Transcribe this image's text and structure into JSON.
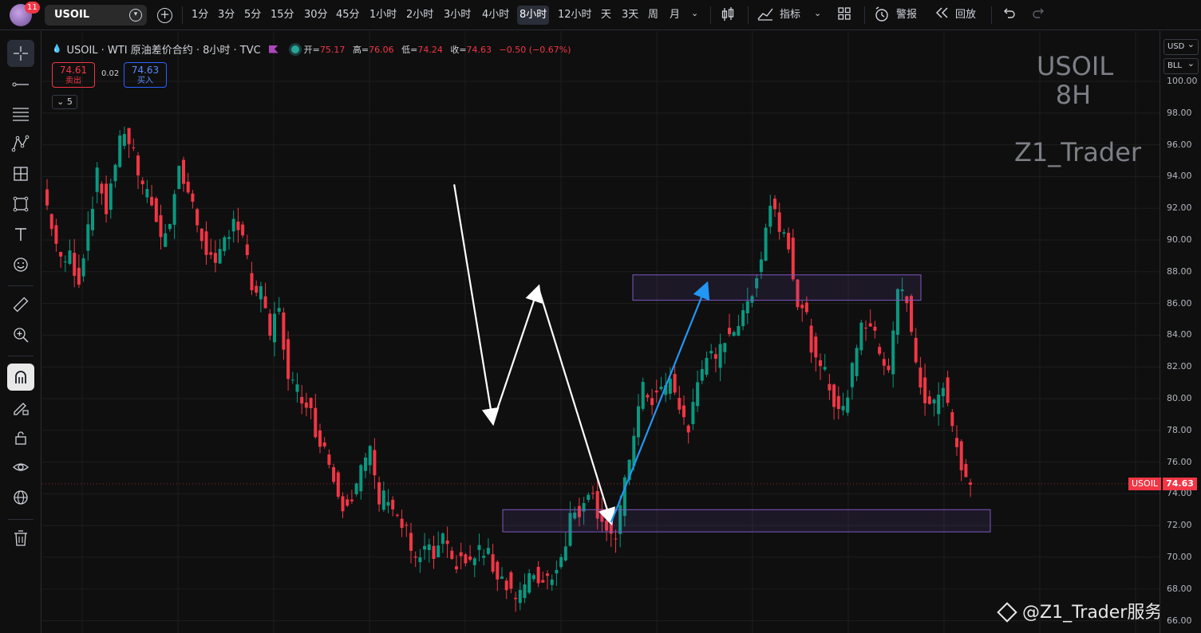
{
  "topbar": {
    "notifications": "11",
    "symbol": "USOIL",
    "intervals": [
      "1分",
      "3分",
      "5分",
      "15分",
      "30分",
      "45分",
      "1小时",
      "2小时",
      "3小时",
      "4小时",
      "8小时",
      "12小时",
      "天",
      "3天",
      "周",
      "月"
    ],
    "active_interval": "8小时",
    "indicators_label": "指标",
    "alert_label": "警报",
    "replay_label": "回放"
  },
  "legend": {
    "title": "USOIL · WTI 原油差价合约 · 8小时 · TVC",
    "open_key": "开=",
    "open": "75.17",
    "high_key": "高=",
    "high": "76.06",
    "low_key": "低=",
    "low": "74.24",
    "close_key": "收=",
    "close": "74.63",
    "change": "−0.50 (−0.67%)",
    "sell_price": "74.61",
    "sell_label": "卖出",
    "spread": "0.02",
    "buy_price": "74.63",
    "buy_label": "买入",
    "indicator_count": "5"
  },
  "watermark": {
    "symbol": "USOIL",
    "interval": "8H",
    "author": "Z1_Trader",
    "footer": "@Z1_Trader服务号"
  },
  "axis": {
    "currency": "USD",
    "unit": "BLL",
    "labels": [
      "100.00",
      "98.00",
      "96.00",
      "94.00",
      "92.00",
      "90.00",
      "88.00",
      "86.00",
      "84.00",
      "82.00",
      "80.00",
      "78.00",
      "76.00",
      "74.00",
      "72.00",
      "70.00",
      "68.00",
      "66.00"
    ],
    "last_symbol": "USOIL",
    "last_price": "74.63"
  },
  "colors": {
    "up": "#089981",
    "down": "#f23645",
    "zone": "#7e57c2",
    "arrow_white": "#ffffff",
    "arrow_blue": "#2196f3"
  },
  "chart_data": {
    "type": "candlestick",
    "ylim": [
      66,
      101
    ],
    "close_path": [
      93.2,
      91.0,
      88.5,
      89.0,
      87.5,
      91.0,
      94.0,
      92.0,
      95.0,
      97.0,
      95.5,
      93.0,
      92.5,
      90.0,
      91.5,
      94.5,
      93.0,
      91.0,
      89.5,
      88.0,
      90.0,
      91.5,
      90.0,
      87.0,
      86.5,
      84.0,
      86.0,
      81.0,
      80.5,
      80.0,
      78.0,
      77.0,
      75.0,
      73.5,
      74.0,
      75.5,
      76.5,
      73.5,
      74.0,
      72.5,
      71.5,
      69.5,
      70.5,
      70.0,
      71.0,
      69.5,
      70.0,
      69.5,
      70.5,
      70.0,
      69.0,
      68.5,
      67.5,
      68.0,
      69.0,
      68.5,
      69.0,
      70.0,
      72.5,
      73.0,
      74.5,
      73.0,
      72.0,
      71.0,
      74.5,
      78.0,
      80.5,
      80.0,
      80.5,
      81.0,
      79.5,
      78.0,
      81.0,
      83.0,
      82.0,
      84.0,
      84.5,
      85.0,
      87.0,
      89.0,
      92.5,
      91.0,
      90.0,
      86.0,
      85.0,
      82.0,
      81.5,
      80.0,
      79.0,
      82.0,
      85.0,
      84.5,
      83.0,
      82.0,
      87.0,
      86.0,
      82.0,
      80.0,
      79.5,
      81.0,
      78.0,
      76.0,
      74.63
    ],
    "zones": [
      {
        "top": 87.8,
        "bottom": 86.2
      },
      {
        "top": 73.0,
        "bottom": 71.6
      }
    ],
    "arrows": [
      {
        "from": [
          89.5,
          93.5
        ],
        "to": [
          98.0,
          78.5
        ],
        "color": "white"
      },
      {
        "from": [
          98.0,
          78.5
        ],
        "to": [
          108.0,
          87.0
        ],
        "color": "white"
      },
      {
        "from": [
          108.0,
          87.0
        ],
        "to": [
          124.0,
          72.2
        ],
        "color": "white"
      },
      {
        "from": [
          124.0,
          72.2
        ],
        "to": [
          145.0,
          87.2
        ],
        "color": "blue"
      }
    ]
  }
}
